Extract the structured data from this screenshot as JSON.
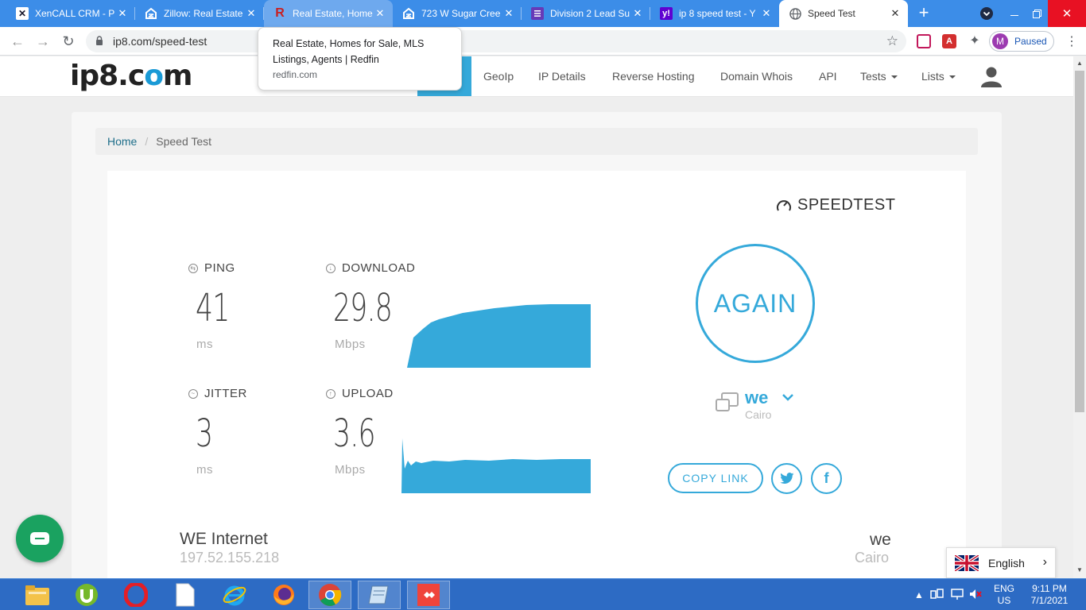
{
  "browser": {
    "tabs": [
      {
        "title": "XenCALL CRM - P",
        "icon": "xencall-icon",
        "state": "normal"
      },
      {
        "title": "Zillow: Real Estate",
        "icon": "zillow-icon",
        "state": "normal"
      },
      {
        "title": "Real Estate, Home",
        "icon": "redfin-icon",
        "state": "hover"
      },
      {
        "title": "723 W Sugar Cree",
        "icon": "zillow-icon",
        "state": "normal"
      },
      {
        "title": "Division 2 Lead Su",
        "icon": "forms-icon",
        "state": "normal"
      },
      {
        "title": "ip 8 speed test - Y",
        "icon": "yahoo-icon",
        "state": "normal"
      },
      {
        "title": "Speed Test",
        "icon": "globe-icon",
        "state": "active"
      }
    ],
    "url": "ip8.com/speed-test",
    "profile_label": "Paused",
    "profile_initial": "M",
    "tooltip": {
      "title": "Real Estate, Homes for Sale, MLS Listings, Agents | Redfin",
      "domain": "redfin.com"
    }
  },
  "site": {
    "logo_main": "ip8.c",
    "logo_dot": "o",
    "logo_end": "m",
    "nav": {
      "home": "Home",
      "geoip": "GeoIp",
      "ip_details": "IP Details",
      "reverse_hosting": "Reverse Hosting",
      "domain_whois": "Domain Whois",
      "api": "API",
      "tests": "Tests",
      "lists": "Lists"
    },
    "breadcrumb": {
      "home": "Home",
      "current": "Speed Test"
    }
  },
  "speedtest": {
    "brand": "SPEEDTEST",
    "ping": {
      "label": "PING",
      "value": "41",
      "unit": "ms"
    },
    "download": {
      "label": "DOWNLOAD",
      "value": "29.8",
      "unit": "Mbps"
    },
    "jitter": {
      "label": "JITTER",
      "value": "3",
      "unit": "ms"
    },
    "upload": {
      "label": "UPLOAD",
      "value": "3.6",
      "unit": "Mbps"
    },
    "again_label": "AGAIN",
    "server_name": "we",
    "server_location": "Cairo",
    "copy_link": "COPY LINK",
    "isp_name": "WE Internet",
    "isp_ip": "197.52.155.218",
    "server_name_2": "we",
    "server_location_2": "Cairo",
    "accent_color": "#35a9da"
  },
  "widgets": {
    "language": "English"
  },
  "taskbar": {
    "apps": [
      "file-explorer-icon",
      "utorrent-icon",
      "opera-icon",
      "document-icon",
      "internet-explorer-icon",
      "firefox-icon",
      "chrome-icon",
      "notepad-icon",
      "anydesk-icon"
    ],
    "lang_top": "ENG",
    "lang_bottom": "US",
    "time": "9:11 PM",
    "date": "7/1/2021"
  }
}
